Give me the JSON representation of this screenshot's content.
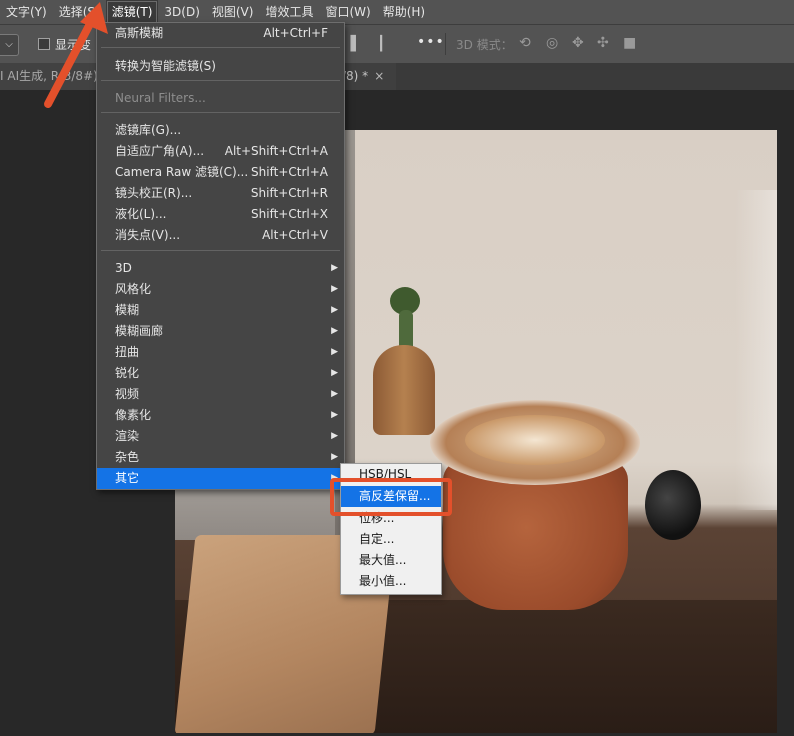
{
  "menubar": {
    "items": [
      "文字(Y)",
      "选择(S)",
      "滤镜(T)",
      "3D(D)",
      "视图(V)",
      "增效工具",
      "窗口(W)",
      "帮助(H)"
    ],
    "active_index": 2
  },
  "options": {
    "dropdown_glyph": "⌵",
    "checkbox_label": "显示变",
    "more_glyph": "•••",
    "mode_label": "3D 模式："
  },
  "tabs": {
    "left_tab": "I AI生成, R(3/8#)",
    "right_tab": "/8) *",
    "close_glyph": "×"
  },
  "filter_menu": {
    "items": [
      {
        "label": "高斯模糊",
        "shortcut": "Alt+Ctrl+F"
      },
      {
        "label": "转换为智能滤镜(S)",
        "shortcut": ""
      },
      {
        "label": "Neural Filters...",
        "shortcut": "",
        "disabled": true
      },
      {
        "label": "滤镜库(G)...",
        "shortcut": ""
      },
      {
        "label": "自适应广角(A)...",
        "shortcut": "Alt+Shift+Ctrl+A"
      },
      {
        "label": "Camera Raw 滤镜(C)...",
        "shortcut": "Shift+Ctrl+A"
      },
      {
        "label": "镜头校正(R)...",
        "shortcut": "Shift+Ctrl+R"
      },
      {
        "label": "液化(L)...",
        "shortcut": "Shift+Ctrl+X"
      },
      {
        "label": "消失点(V)...",
        "shortcut": "Alt+Ctrl+V"
      },
      {
        "label": "3D",
        "submenu": true
      },
      {
        "label": "风格化",
        "submenu": true
      },
      {
        "label": "模糊",
        "submenu": true
      },
      {
        "label": "模糊画廊",
        "submenu": true
      },
      {
        "label": "扭曲",
        "submenu": true
      },
      {
        "label": "锐化",
        "submenu": true
      },
      {
        "label": "视频",
        "submenu": true
      },
      {
        "label": "像素化",
        "submenu": true
      },
      {
        "label": "渲染",
        "submenu": true
      },
      {
        "label": "杂色",
        "submenu": true
      },
      {
        "label": "其它",
        "submenu": true,
        "highlighted": true
      }
    ],
    "submenu_arrow": "▶"
  },
  "other_submenu": {
    "items": [
      "HSB/HSL",
      "高反差保留...",
      "位移...",
      "自定...",
      "最大值...",
      "最小值..."
    ],
    "selected_index": 1
  },
  "colors": {
    "accent": "#1473e6",
    "callout": "#e3502b"
  }
}
